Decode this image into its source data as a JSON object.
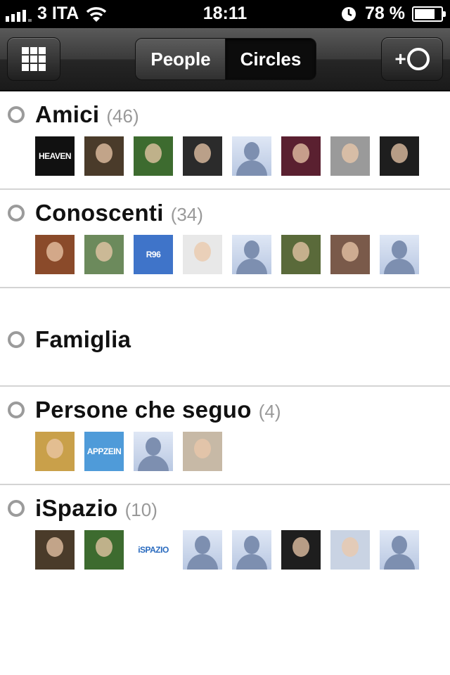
{
  "status_bar": {
    "carrier": "3 ITA",
    "time": "18:11",
    "battery": "78 %",
    "battery_level": 0.78
  },
  "nav": {
    "segments": [
      "People",
      "Circles"
    ],
    "selected_segment": "Circles",
    "left_icon": "grid-icon",
    "right_icon": "add-circle-icon"
  },
  "circles": [
    {
      "name": "Amici",
      "count": "(46)",
      "avatars": [
        {
          "kind": "photo",
          "bg": "#111111",
          "text": "HEAVEN"
        },
        {
          "kind": "photo",
          "bg": "#4a3b2a"
        },
        {
          "kind": "photo",
          "bg": "#3d6b2f"
        },
        {
          "kind": "photo",
          "bg": "#2b2b2b"
        },
        {
          "kind": "default"
        },
        {
          "kind": "photo",
          "bg": "#5a2030"
        },
        {
          "kind": "photo",
          "bg": "#9a9a9a"
        },
        {
          "kind": "photo",
          "bg": "#1e1e1e"
        }
      ]
    },
    {
      "name": "Conoscenti",
      "count": "(34)",
      "avatars": [
        {
          "kind": "photo",
          "bg": "#8a4a2a"
        },
        {
          "kind": "photo",
          "bg": "#6c8a5c"
        },
        {
          "kind": "photo",
          "bg": "#3f74c9",
          "text": "R96"
        },
        {
          "kind": "photo",
          "bg": "#e8e8e8"
        },
        {
          "kind": "default"
        },
        {
          "kind": "photo",
          "bg": "#5a6a3a"
        },
        {
          "kind": "photo",
          "bg": "#7a5a4a"
        },
        {
          "kind": "default"
        }
      ]
    },
    {
      "name": "Famiglia",
      "count": "",
      "avatars": []
    },
    {
      "name": "Persone che seguo",
      "count": "(4)",
      "avatars": [
        {
          "kind": "photo",
          "bg": "#c9a04a"
        },
        {
          "kind": "photo",
          "bg": "#4f9bd9",
          "text": "APPZEIN"
        },
        {
          "kind": "default"
        },
        {
          "kind": "photo",
          "bg": "#c7b9a6"
        }
      ]
    },
    {
      "name": "iSpazio",
      "count": "(10)",
      "avatars": [
        {
          "kind": "photo",
          "bg": "#4a3b2a"
        },
        {
          "kind": "photo",
          "bg": "#3d6b2f"
        },
        {
          "kind": "photo",
          "bg": "#ffffff",
          "text": "iSPAZIO",
          "textColor": "#2a6bbf"
        },
        {
          "kind": "default"
        },
        {
          "kind": "default"
        },
        {
          "kind": "photo",
          "bg": "#1e1e1e"
        },
        {
          "kind": "photo",
          "bg": "#c9d3e3"
        },
        {
          "kind": "default"
        }
      ]
    }
  ]
}
